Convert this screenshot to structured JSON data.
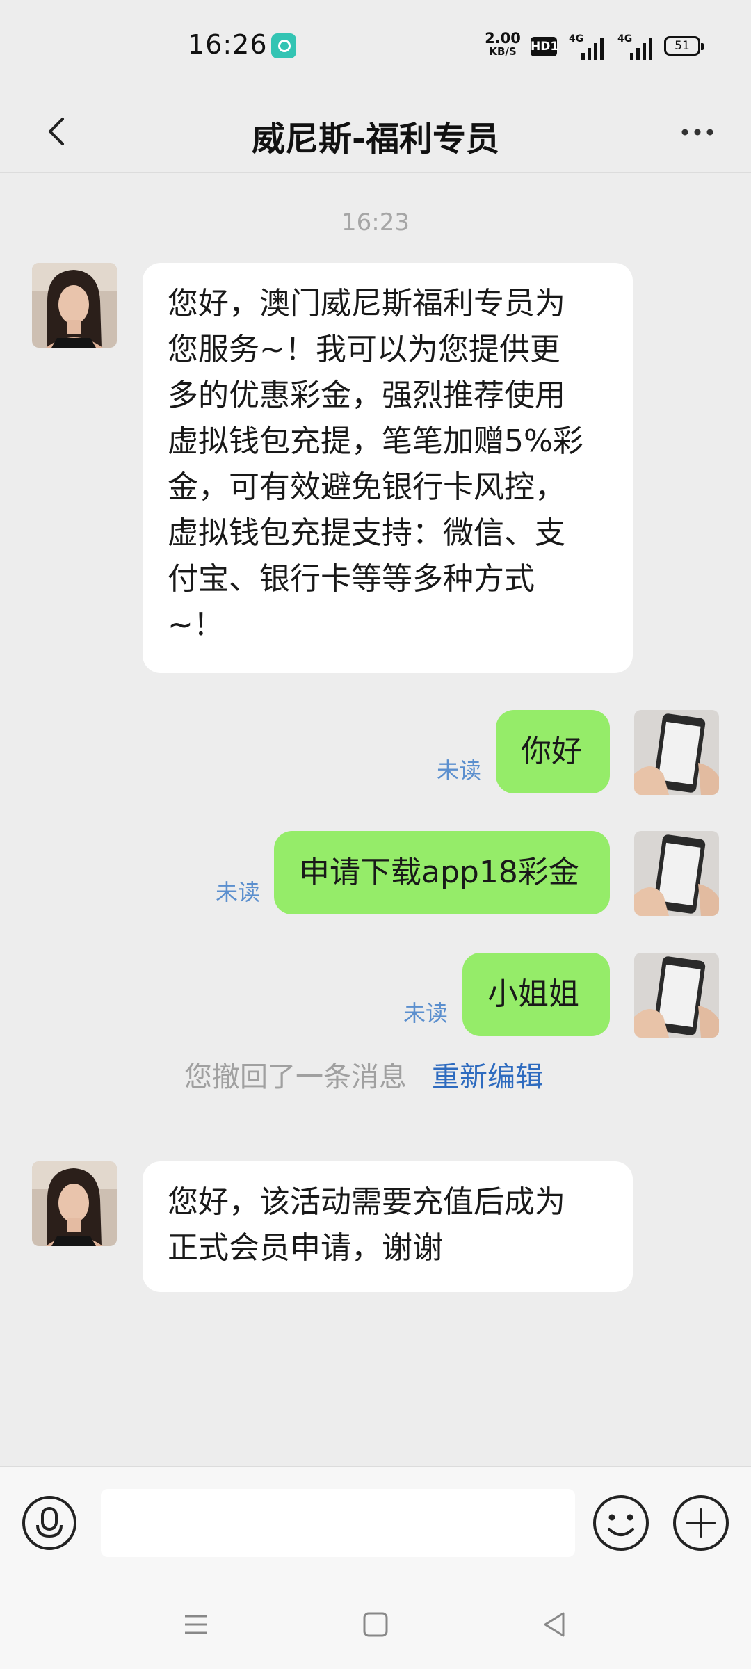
{
  "status_bar": {
    "time": "16:26",
    "net_speed_value": "2.00",
    "net_speed_unit": "KB/S",
    "hd_badge": "HD1",
    "signal1_label": "4G",
    "signal2_label": "4G",
    "battery": "51"
  },
  "header": {
    "title": "威尼斯-福利专员"
  },
  "chat": {
    "timestamp": "16:23",
    "messages": [
      {
        "direction": "incoming",
        "lines": [
          "您好，澳门威尼斯福利专员为",
          "您服务~！我可以为您提供更",
          "多的优惠彩金，强烈推荐使用",
          "虚拟钱包充提，笔笔加赠5%彩",
          "金，可有效避免银行卡风控，",
          "虚拟钱包充提支持：微信、支",
          "付宝、银行卡等等多种方式",
          "~！"
        ]
      },
      {
        "direction": "outgoing",
        "text": "你好",
        "status": "未读"
      },
      {
        "direction": "outgoing",
        "text": "申请下载app18彩金",
        "status": "未读"
      },
      {
        "direction": "outgoing",
        "text": "小姐姐",
        "status": "未读"
      },
      {
        "direction": "incoming",
        "lines": [
          "您好，该活动需要充值后成为",
          "正式会员申请，谢谢"
        ]
      }
    ],
    "recall_notice": "您撤回了一条消息",
    "recall_action": "重新编辑"
  },
  "input_bar": {
    "placeholder": ""
  },
  "colors": {
    "background": "#ededed",
    "outgoing_bubble": "#95ec69",
    "incoming_bubble": "#ffffff",
    "unread_text": "#5b8fce",
    "link": "#2e6bbf"
  },
  "icons": [
    "back-arrow-icon",
    "more-dots-icon",
    "voice-icon",
    "emoji-icon",
    "plus-icon",
    "menu-nav-icon",
    "home-nav-icon",
    "back-nav-icon"
  ]
}
